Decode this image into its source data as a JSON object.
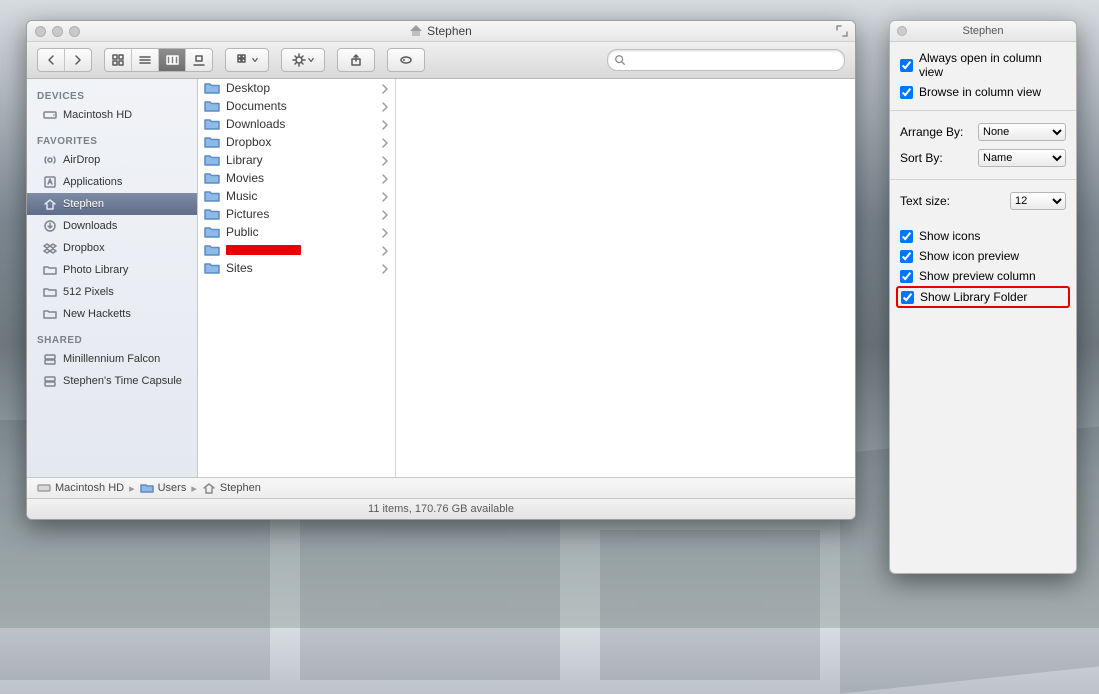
{
  "finder": {
    "title": "Stephen",
    "search_placeholder": "",
    "sidebar": {
      "sections": [
        {
          "heading": "DEVICES",
          "items": [
            {
              "id": "macintosh-hd",
              "label": "Macintosh HD",
              "icon": "disk-icon",
              "selected": false
            }
          ]
        },
        {
          "heading": "FAVORITES",
          "items": [
            {
              "id": "airdrop",
              "label": "AirDrop",
              "icon": "airdrop-icon",
              "selected": false
            },
            {
              "id": "applications",
              "label": "Applications",
              "icon": "app-icon",
              "selected": false
            },
            {
              "id": "stephen",
              "label": "Stephen",
              "icon": "home-icon",
              "selected": true
            },
            {
              "id": "downloads",
              "label": "Downloads",
              "icon": "download-icon",
              "selected": false
            },
            {
              "id": "dropbox",
              "label": "Dropbox",
              "icon": "dropbox-icon",
              "selected": false
            },
            {
              "id": "photo-library",
              "label": "Photo Library",
              "icon": "folder-icon",
              "selected": false
            },
            {
              "id": "512-pixels",
              "label": "512 Pixels",
              "icon": "folder-icon",
              "selected": false
            },
            {
              "id": "new-hacketts",
              "label": "New Hacketts",
              "icon": "folder-icon",
              "selected": false
            }
          ]
        },
        {
          "heading": "SHARED",
          "items": [
            {
              "id": "minillennium-falcon",
              "label": "Minillennium Falcon",
              "icon": "server-icon",
              "selected": false
            },
            {
              "id": "stephens-time-capsule",
              "label": "Stephen's Time Capsule",
              "icon": "server-icon",
              "selected": false
            }
          ]
        }
      ]
    },
    "column": {
      "items": [
        {
          "label": "Desktop",
          "redacted": false
        },
        {
          "label": "Documents",
          "redacted": false
        },
        {
          "label": "Downloads",
          "redacted": false
        },
        {
          "label": "Dropbox",
          "redacted": false
        },
        {
          "label": "Library",
          "redacted": false
        },
        {
          "label": "Movies",
          "redacted": false
        },
        {
          "label": "Music",
          "redacted": false
        },
        {
          "label": "Pictures",
          "redacted": false
        },
        {
          "label": "Public",
          "redacted": false
        },
        {
          "label": "",
          "redacted": true
        },
        {
          "label": "Sites",
          "redacted": false
        }
      ]
    },
    "path": [
      {
        "label": "Macintosh HD",
        "icon": "disk-icon"
      },
      {
        "label": "Users",
        "icon": "folder-icon"
      },
      {
        "label": "Stephen",
        "icon": "home-icon"
      }
    ],
    "status": "11 items, 170.76 GB available"
  },
  "inspector": {
    "title": "Stephen",
    "top_checks": [
      "Always open in column view",
      "Browse in column view"
    ],
    "arrange_label": "Arrange By:",
    "arrange_value": "None",
    "sort_label": "Sort By:",
    "sort_value": "Name",
    "textsize_label": "Text size:",
    "textsize_value": "12",
    "view_checks": [
      "Show icons",
      "Show icon preview",
      "Show preview column",
      "Show Library Folder"
    ],
    "highlight_index": 3
  }
}
